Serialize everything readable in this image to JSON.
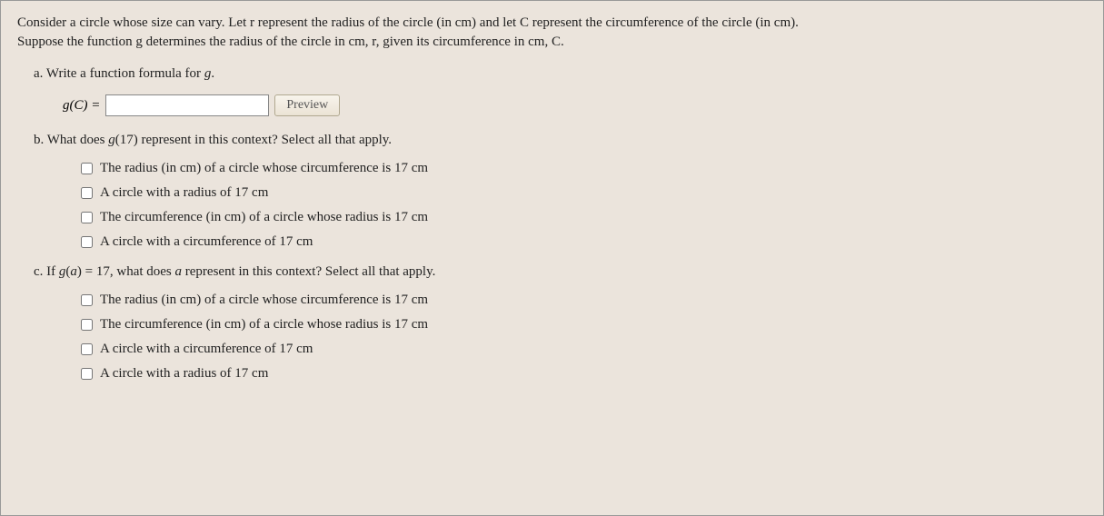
{
  "intro_line1": "Consider a circle whose size can vary. Let r represent the radius of the circle (in cm) and let C represent the circumference of the circle (in cm).",
  "intro_line2": "Suppose the function g determines the radius of the circle in cm, r, given its circumference in cm, C.",
  "part_a": {
    "label": "a. Write a function formula for g.",
    "formula_prefix": "g(C) = ",
    "preview_button": "Preview"
  },
  "part_b": {
    "label": "b. What does g(17) represent in this context? Select all that apply.",
    "options": [
      "The radius (in cm) of a circle whose circumference is 17 cm",
      "A circle with a radius of 17 cm",
      "The circumference (in cm) of a circle whose radius is 17 cm",
      "A circle with a circumference of 17 cm"
    ]
  },
  "part_c": {
    "label": "c. If g(a) = 17, what does a represent in this context? Select all that apply.",
    "options": [
      "The radius (in cm) of a circle whose circumference is 17 cm",
      "The circumference (in cm) of a circle whose radius is 17 cm",
      "A circle with a circumference of 17 cm",
      "A circle with a radius of 17 cm"
    ]
  }
}
